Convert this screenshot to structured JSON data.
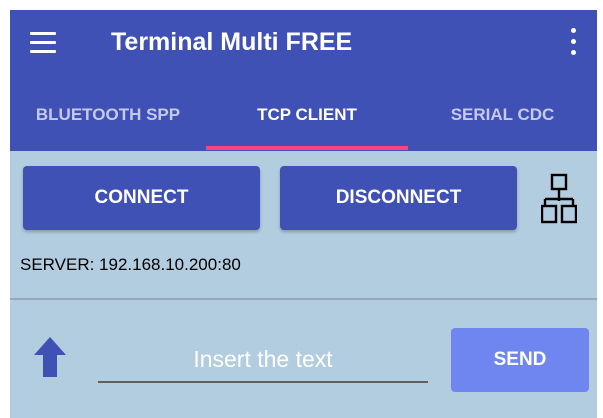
{
  "colors": {
    "primary": "#3f51b5",
    "accent": "#ff4081",
    "content_background": "#b3cde0",
    "send_button": "#6f86f0",
    "inactive_tab_text": "#c5cae9"
  },
  "toolbar": {
    "menu_icon": "hamburger-menu-icon",
    "title": "Terminal Multi FREE",
    "overflow_icon": "vertical-ellipsis-icon"
  },
  "tabs": [
    {
      "label": "BLUETOOTH SPP",
      "active": false
    },
    {
      "label": "TCP CLIENT",
      "active": true
    },
    {
      "label": "SERIAL CDC",
      "active": false
    }
  ],
  "actions": {
    "connect_label": "CONNECT",
    "disconnect_label": "DISCONNECT",
    "network_icon": "network-topology-icon"
  },
  "server": {
    "text": "SERVER: 192.168.10.200:80"
  },
  "input": {
    "upload_icon": "arrow-up-icon",
    "placeholder": "Insert the text",
    "value": "",
    "send_label": "SEND"
  }
}
